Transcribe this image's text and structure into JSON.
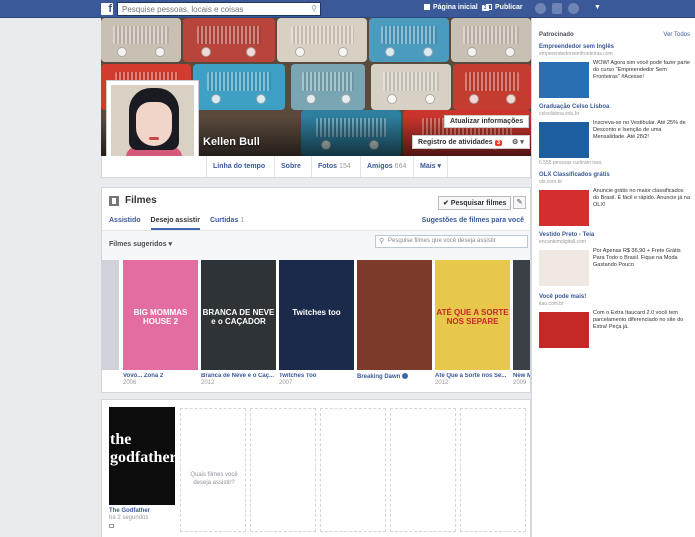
{
  "topbar": {
    "logo": "f",
    "search_placeholder": "Pesquise pessoas, locais e coisas",
    "home_label": "Página inicial",
    "home_count": "3",
    "publish_label": "Publicar"
  },
  "cover": {
    "name": "Kellen Bull",
    "update_info": "Atualizar informações",
    "activity_log": "Registro de atividades",
    "activity_count": "3",
    "radio_colors": [
      "#c9c0b4",
      "#b7453b",
      "#d8d0c2",
      "#4b9bbf",
      "#c9c0b4",
      "#d23b2e",
      "#3da0c4",
      "#7aa6b3",
      "#d7d0c4",
      "#c43c2f",
      "#2f7f9f",
      "#c9352d"
    ]
  },
  "profile_nav": {
    "items": [
      {
        "label": "Linha do tempo",
        "count": ""
      },
      {
        "label": "Sobre",
        "count": ""
      },
      {
        "label": "Fotos",
        "count": "154"
      },
      {
        "label": "Amigos",
        "count": "664"
      },
      {
        "label": "Mais ▾",
        "count": ""
      }
    ]
  },
  "movies": {
    "title": "Filmes",
    "search_button": "✔ Pesquisar filmes",
    "edit_icon": "✎",
    "tabs": [
      {
        "label": "Assistido",
        "count": ""
      },
      {
        "label": "Desejo assistir",
        "count": ""
      },
      {
        "label": "Curtidas",
        "count": "1"
      }
    ],
    "suggestions_link": "Sugestões de filmes para você",
    "filter_label": "Filmes sugeridos ▾",
    "filter_placeholder": "Pesquise filmes que você deseja assistir",
    "posters": [
      {
        "title": "Vovó... Zona 2",
        "year": "2006",
        "bg": "#e36da0",
        "art": "BIG MOMMAS HOUSE 2",
        "verified": false
      },
      {
        "title": "Branca de Neve e o Caç...",
        "year": "2012",
        "bg": "#2e3338",
        "art": "BRANCA DE NEVE e o CAÇADOR",
        "verified": false
      },
      {
        "title": "Twitches Too",
        "year": "2007",
        "bg": "#1b2a4a",
        "art": "Twitches too",
        "verified": false
      },
      {
        "title": "Breaking Dawn",
        "year": "",
        "bg": "#7b3a2a",
        "art": "",
        "verified": true
      },
      {
        "title": "Até Que a Sorte nos Se...",
        "year": "2012",
        "bg": "#e7c84b",
        "art": "ATÉ QUE A SORTE NOS SEPARE",
        "verified": false
      },
      {
        "title": "New Mo...",
        "year": "2009",
        "bg": "#3b3f47",
        "art": "",
        "verified": false
      }
    ],
    "wishlist": {
      "title": "The Godfather",
      "time": "há 2 segundos",
      "poster_text": "the godfather",
      "prompt": "Quais filmes você deseja assistir?"
    }
  },
  "sidebar": {
    "header": "Patrocinado",
    "see_all": "Ver Todos",
    "ads": [
      {
        "title": "Empreendedor sem Inglês",
        "domain": "empreendedorsemfronteiras.com",
        "text": "WOW! Agora sim você pode fazer parte do curso \"Empreendedor Sem Fronteiras\" #Acesse!",
        "extra": "",
        "img": "#2a6fb3"
      },
      {
        "title": "Graduação Celso Lisboa",
        "domain": "celsolisboa.edu.br",
        "text": "Inscreva-se no Vestibular. Até 25% de Desconto e Isenção de uma Mensalidade. Até 28/2!",
        "extra": "6.555 pessoas curtiram isso.",
        "img": "#1d5fa0"
      },
      {
        "title": "OLX Classificados grátis",
        "domain": "olx.com.br",
        "text": "Anuncie grátis no maior classificados do Brasil. É fácil e rápido. Anuncie já na OLX!",
        "extra": "",
        "img": "#d32f2f"
      },
      {
        "title": "Vestido Preto - Teia",
        "domain": "encantemdigitall.com",
        "text": "Por Apenas R$ 36,90 + Frete Grátis Para Todo o Brasil. Fique na Moda Gastando Pouco",
        "extra": "",
        "img": "#efe9e2"
      },
      {
        "title": "Você pode mais!",
        "domain": "itau.com.br",
        "text": "Com o Extra Itaucard 2.0 você tem parcelamento diferenciado no site do Extra! Peça já.",
        "extra": "",
        "img": "#c62828"
      }
    ]
  }
}
